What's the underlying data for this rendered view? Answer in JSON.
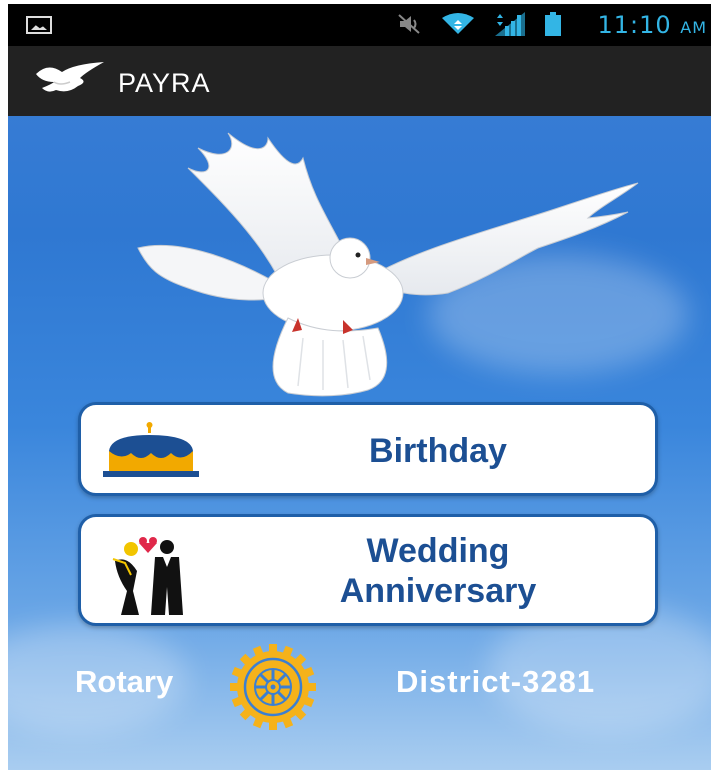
{
  "status_bar": {
    "time": "11:10",
    "ampm": "AM",
    "icons": [
      "image-notification-icon",
      "mute-icon",
      "wifi-icon",
      "signal-icon",
      "battery-icon"
    ]
  },
  "action_bar": {
    "title": "PAYRA",
    "logo_icon": "dove-logo-icon"
  },
  "main": {
    "hero_image": "white-dove-icon",
    "buttons": [
      {
        "label": "Birthday",
        "icon": "birthday-cake-icon"
      },
      {
        "label": "Wedding\nAnniversary",
        "icon": "wedding-couple-icon"
      }
    ]
  },
  "footer": {
    "left_text": "Rotary",
    "right_text": "District-3281",
    "emblem": "rotary-wheel-icon"
  },
  "colors": {
    "button_text": "#1c4f93",
    "button_border": "#1f5fa8",
    "status_accent": "#33b5e5",
    "rotary_gold": "#f5b21a",
    "sky": "#3d7fd6"
  }
}
